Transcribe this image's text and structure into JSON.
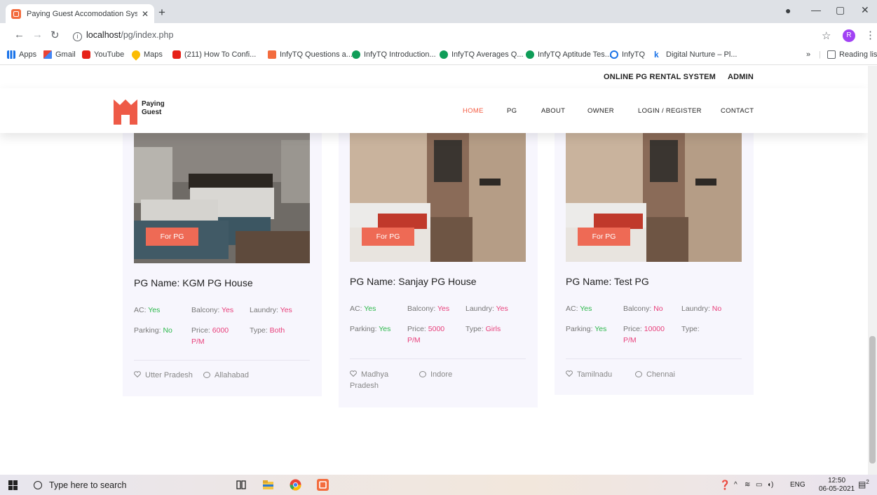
{
  "browser": {
    "tab_title": "Paying Guest Accomodation Syst",
    "url_host": "localhost",
    "url_path": "/pg/index.php",
    "bookmarks": [
      {
        "icon": "apps-grid-icon",
        "label": "Apps"
      },
      {
        "icon": "gmail-icon",
        "label": "Gmail"
      },
      {
        "icon": "youtube-icon",
        "label": "YouTube"
      },
      {
        "icon": "maps-icon",
        "label": "Maps"
      },
      {
        "icon": "youtube-icon",
        "label": "(211) How To Confi..."
      },
      {
        "icon": "infytq-icon",
        "label": "InfyTQ Questions a..."
      },
      {
        "icon": "infytq-green-icon",
        "label": "InfyTQ Introduction..."
      },
      {
        "icon": "infytq-green-icon",
        "label": "InfyTQ Averages Q..."
      },
      {
        "icon": "infytq-green-icon",
        "label": "InfyTQ Aptitude Tes..."
      },
      {
        "icon": "link-icon",
        "label": "InfyTQ"
      },
      {
        "icon": "k-icon",
        "label": "Digital Nurture – Pl..."
      }
    ],
    "more_bookmarks": "»",
    "reading_list": "Reading list",
    "profile_initial": "R"
  },
  "site": {
    "topbar": {
      "rental_system": "ONLINE PG RENTAL SYSTEM",
      "admin": "ADMIN"
    },
    "logo_line1": "Paying",
    "logo_line2": "Guest",
    "nav": [
      "HOME",
      "PG",
      "ABOUT",
      "OWNER",
      "LOGIN / REGISTER",
      "CONTACT"
    ],
    "accent_color": "#f45c43",
    "cards": [
      {
        "badge": "For PG",
        "name": "PG Name: KGM PG House",
        "ac_label": "AC:",
        "ac": "Yes",
        "balcony_label": "Balcony:",
        "balcony": "Yes",
        "laundry_label": "Laundry:",
        "laundry": "Yes",
        "parking_label": "Parking:",
        "parking": "No",
        "price_label": "Price:",
        "price": "6000",
        "price_unit": "P/M",
        "type_label": "Type:",
        "type": "Both",
        "state": "Utter Pradesh",
        "city": "Allahabad"
      },
      {
        "badge": "For PG",
        "name": "PG Name: Sanjay PG House",
        "ac_label": "AC:",
        "ac": "Yes",
        "balcony_label": "Balcony:",
        "balcony": "Yes",
        "laundry_label": "Laundry:",
        "laundry": "Yes",
        "parking_label": "Parking:",
        "parking": "Yes",
        "price_label": "Price:",
        "price": "5000",
        "price_unit": "P/M",
        "type_label": "Type:",
        "type": "Girls",
        "state": "Madhya Pradesh",
        "city": "Indore"
      },
      {
        "badge": "For PG",
        "name": "PG Name: Test PG",
        "ac_label": "AC:",
        "ac": "Yes",
        "balcony_label": "Balcony:",
        "balcony": "No",
        "laundry_label": "Laundry:",
        "laundry": "No",
        "parking_label": "Parking:",
        "parking": "Yes",
        "price_label": "Price:",
        "price": "10000",
        "price_unit": "P/M",
        "type_label": "Type:",
        "type": "",
        "state": "Tamilnadu",
        "city": "Chennai"
      }
    ]
  },
  "taskbar": {
    "search_placeholder": "Type here to search",
    "lang": "ENG",
    "time": "12:50",
    "date": "06-05-2021",
    "notification_count": "2"
  }
}
